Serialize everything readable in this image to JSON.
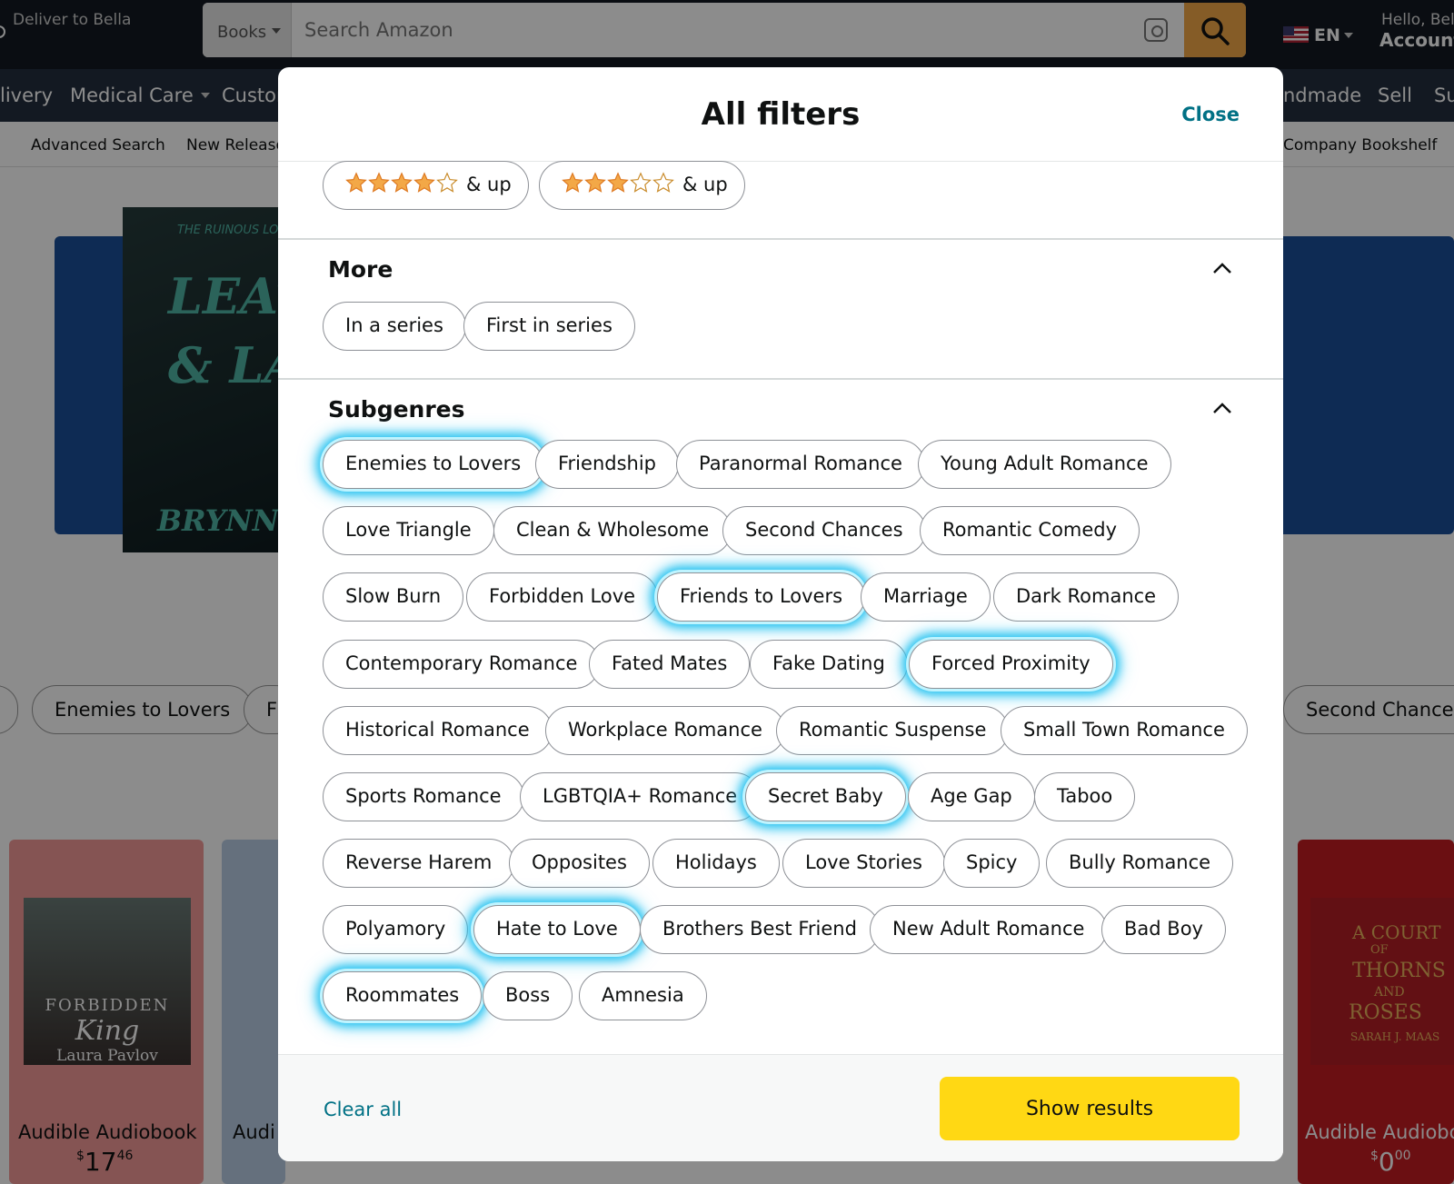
{
  "header": {
    "deliver_to": "Deliver to Bella",
    "search_category": "Books",
    "search_placeholder": "Search Amazon",
    "language": "EN",
    "hello": "Hello, Bel",
    "account": "Account"
  },
  "nav": {
    "delivery": "livery",
    "medical_care": "Medical Care",
    "customer": "Custor",
    "handmade": "ndmade",
    "sell": "Sell",
    "su": "Su"
  },
  "subnav": {
    "advanced_search": "Advanced Search",
    "new_releases": "New Release",
    "company_bookshelf": "Company Bookshelf"
  },
  "background": {
    "cover_top": "THE RUINOUS LOVE TR",
    "cover_title_1": "LEATHER",
    "cover_title_2": "& LARK",
    "cover_author": "BRYNNE WE",
    "chip_enemies": "Enemies to Lovers",
    "chip_f": "F",
    "chip_second": "Second Chances",
    "product_1": {
      "label": "Audible Audiobook",
      "price_symbol": "$",
      "price_whole": "17",
      "price_fraction": "46",
      "cover_line_1": "FORBIDDEN",
      "cover_line_2": "King",
      "cover_line_3": "Laura Pavlov"
    },
    "product_2": {
      "label": "Audi"
    },
    "product_last": {
      "label": "Audible Audiobo",
      "price_symbol": "$",
      "price_whole": "0",
      "price_fraction": "00",
      "cover_line_1": "A COURT",
      "cover_line_2": "OF",
      "cover_line_3": "THORNS",
      "cover_line_4": "AND",
      "cover_line_5": "ROSES",
      "cover_line_6": "SARAH J. MAAS"
    }
  },
  "modal": {
    "title": "All filters",
    "close_label": "Close",
    "ratings": [
      {
        "stars": 4,
        "label": "& up"
      },
      {
        "stars": 3,
        "label": "& up"
      }
    ],
    "more": {
      "title": "More",
      "options": [
        "In a series",
        "First in series"
      ]
    },
    "subgenres": {
      "title": "Subgenres",
      "options": [
        {
          "label": "Enemies to Lovers",
          "selected": true
        },
        {
          "label": "Friendship",
          "selected": false
        },
        {
          "label": "Paranormal Romance",
          "selected": false
        },
        {
          "label": "Young Adult Romance",
          "selected": false
        },
        {
          "label": "Love Triangle",
          "selected": false
        },
        {
          "label": "Clean & Wholesome",
          "selected": false
        },
        {
          "label": "Second Chances",
          "selected": false
        },
        {
          "label": "Romantic Comedy",
          "selected": false
        },
        {
          "label": "Slow Burn",
          "selected": false
        },
        {
          "label": "Forbidden Love",
          "selected": false
        },
        {
          "label": "Friends to Lovers",
          "selected": true
        },
        {
          "label": "Marriage",
          "selected": false
        },
        {
          "label": "Dark Romance",
          "selected": false
        },
        {
          "label": "Contemporary Romance",
          "selected": false
        },
        {
          "label": "Fated Mates",
          "selected": false
        },
        {
          "label": "Fake Dating",
          "selected": false
        },
        {
          "label": "Forced Proximity",
          "selected": true
        },
        {
          "label": "Historical Romance",
          "selected": false
        },
        {
          "label": "Workplace Romance",
          "selected": false
        },
        {
          "label": "Romantic Suspense",
          "selected": false
        },
        {
          "label": "Small Town Romance",
          "selected": false
        },
        {
          "label": "Sports Romance",
          "selected": false
        },
        {
          "label": "LGBTQIA+ Romance",
          "selected": false
        },
        {
          "label": "Secret Baby",
          "selected": true
        },
        {
          "label": "Age Gap",
          "selected": false
        },
        {
          "label": "Taboo",
          "selected": false
        },
        {
          "label": "Reverse Harem",
          "selected": false
        },
        {
          "label": "Opposites",
          "selected": false
        },
        {
          "label": "Holidays",
          "selected": false
        },
        {
          "label": "Love Stories",
          "selected": false
        },
        {
          "label": "Spicy",
          "selected": false
        },
        {
          "label": "Bully Romance",
          "selected": false
        },
        {
          "label": "Polyamory",
          "selected": false
        },
        {
          "label": "Hate to Love",
          "selected": true
        },
        {
          "label": "Brothers Best Friend",
          "selected": false
        },
        {
          "label": "New Adult Romance",
          "selected": false
        },
        {
          "label": "Bad Boy",
          "selected": false
        },
        {
          "label": "Roommates",
          "selected": true
        },
        {
          "label": "Boss",
          "selected": false
        },
        {
          "label": "Amnesia",
          "selected": false
        }
      ]
    },
    "footer": {
      "clear_all": "Clear all",
      "show_results": "Show results"
    }
  },
  "icons": {
    "search": "search-icon",
    "camera": "camera-search-icon",
    "chevron": "chevron-up-icon",
    "star": "star-icon"
  },
  "colors": {
    "topbar": "#131921",
    "navbar": "#232f3e",
    "search_button": "#f3a847",
    "link": "#007185",
    "primary_button": "#ffd814",
    "star": "#f3a847",
    "selected_glow": "#29c3f0"
  }
}
